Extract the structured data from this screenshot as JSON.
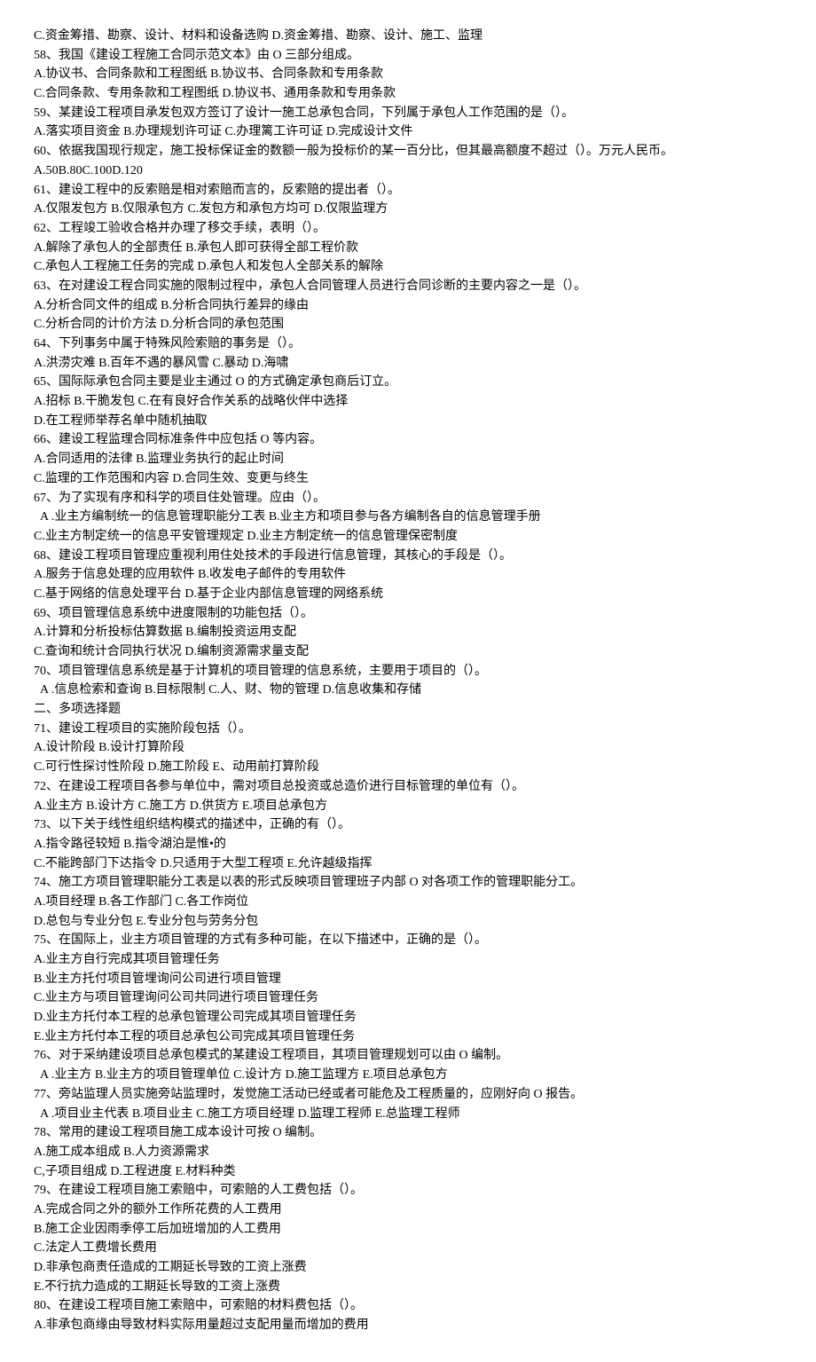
{
  "lines": [
    "C.资金筹措、勘察、设计、材料和设备选购 D.资金筹措、勘察、设计、施工、监理",
    "58、我国《建设工程施工合同示范文本》由 O 三部分组成。",
    "A.协议书、合同条款和工程图纸 B.协议书、合同条款和专用条款",
    "C.合同条款、专用条款和工程图纸 D.协议书、通用条款和专用条款",
    "59、某建设工程项目承发包双方签订了设计一施工总承包合同，下列属于承包人工作范围的是（）。",
    "A.落实项目资金 B.办理规划许可证 C.办理篱工许可证 D.完成设计文件",
    "60、依据我国现行规定，施工投标保证金的数额一般为投标价的某一百分比，但其最高额度不超过（）。万元人民币。",
    "A.50B.80C.100D.120",
    "61、建设工程中的反索赔是相对索赔而言的，反索赔的提出者（）。",
    "A.仅限发包方 B.仅限承包方 C.发包方和承包方均可 D.仅限监理方",
    "62、工程竣工验收合格并办理了移交手续，表明（）。",
    "A.解除了承包人的全部责任 B.承包人即可获得全部工程价款",
    "C.承包人工程施工任务的完成 D.承包人和发包人全部关系的解除",
    "63、在对建设工程合同实施的限制过程中，承包人合同管理人员进行合同诊断的主要内容之一是（）。",
    "A.分析合同文件的组成 B.分析合同执行差异的缘由",
    "C.分析合同的计价方法 D.分析合同的承包范围",
    "64、下列事务中属于特殊风险索赔的事务是（）。",
    "A.洪涝灾难 B.百年不遇的暴风雪 C.暴动 D.海啸",
    "65、国际际承包合同主要是业主通过 O 的方式确定承包商后订立。",
    "A.招标 B.干脆发包 C.在有良好合作关系的战略伙伴中选择",
    "D.在工程师举荐名单中随机抽取",
    "66、建设工程监理合同标准条件中应包括 O 等内容。",
    "A.合同适用的法律 B.监理业务执行的起止时间",
    "C.监理的工作范围和内容 D.合同生效、变更与终生",
    "67、为了实现有序和科学的项目住处管理。应由（）。",
    "  A .业主方编制统一的信息管理职能分工表 B.业主方和项目参与各方编制各自的信息管理手册",
    "C.业主方制定统一的信息平安管理规定 D.业主方制定统一的信息管理保密制度",
    "68、建设工程项目管理应重视利用住处技术的手段进行信息管理，其核心的手段是（）。",
    "A.服务于信息处理的应用软件 B.收发电子邮件的专用软件",
    "C.基于网络的信息处理平台 D.基于企业内部信息管理的网络系统",
    "69、项目管理信息系统中进度限制的功能包括（）。",
    "A.计算和分析投标估算数据 B.编制投资运用支配",
    "C.查询和统计合同执行状况 D.编制资源需求量支配",
    "70、项目管理信息系统是基于计算机的项目管理的信息系统，主要用于项目的（）。",
    "  A .信息检索和查询 B.目标限制 C.人、财、物的管理 D.信息收集和存储",
    "二、多项选择题",
    "71、建设工程项目的实施阶段包括（）。",
    "A.设计阶段 B.设计打算阶段",
    "C.可行性探讨性阶段 D.施工阶段 E、动用前打算阶段",
    "72、在建设工程项目各参与单位中，需对项目总投资或总造价进行目标管理的单位有（）。",
    "A.业主方 B.设计方 C.施工方 D.供货方 E.项目总承包方",
    "73、以下关于线性组织结构模式的描述中，正确的有（）。",
    "A.指令路径较短 B.指令湖泊是惟•的",
    "C.不能跨部门下达指令 D.只适用于大型工程项 E.允许越级指挥",
    "74、施工方项目管理职能分工表是以表的形式反映项目管理班子内部 O 对各项工作的管理职能分工。",
    "A.项目经理 B.各工作部门 C.各工作岗位",
    "D.总包与专业分包 E.专业分包与劳务分包",
    "75、在国际上，业主方项目管理的方式有多种可能，在以下描述中，正确的是（）。",
    "A.业主方自行完成其项目管理任务",
    "B.业主方托付项目管埋询问公司进行项目管理",
    "C.业主方与项目管理询问公司共同进行项目管理任务",
    "D.业主方托付本工程的总承包管理公司完成其项目管理任务",
    "E.业主方托付本工程的项目总承包公司完成其项目管理任务",
    "76、对于采纳建设项目总承包模式的某建设工程项目，其项目管理规划可以由 O 编制。",
    "  A .业主方 B.业主方的项目管理单位 C.设计方 D.施工监理方 E.项目总承包方",
    "77、旁站监理人员实施旁站监理时，发觉施工活动已经或者可能危及工程质量的，应刚好向 O 报告。",
    "  A .项目业主代表 B.项目业主 C.施工方项目经理 D.监理工程师 E.总监理工程师",
    "78、常用的建设工程项目施工成本设计可按 O 编制。",
    "A.施工成本组成 B.人力资源需求",
    "C,子项目组成 D.工程进度 E.材料种类",
    "79、在建设工程项目施工索赔中，可索赔的人工费包括（）。",
    "A.完成合同之外的额外工作所花费的人工费用",
    "B.施工企业因雨季停工后加班增加的人工费用",
    "C.法定人工费增长费用",
    "D.非承包商责任造成的工期延长导致的工资上涨费",
    "E.不行抗力造成的工期延长导致的工资上涨费",
    "80、在建设工程项目施工索赔中，可索赔的材料费包括（）。",
    "A.非承包商缘由导致材料实际用量超过支配用量而增加的费用"
  ]
}
